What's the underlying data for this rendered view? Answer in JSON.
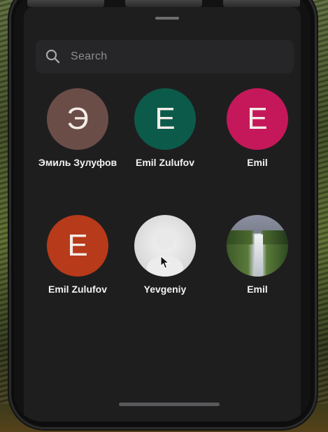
{
  "search": {
    "placeholder": "Search"
  },
  "contacts": [
    {
      "initial": "Э",
      "name": "Эмиль Зулуфов",
      "color": "#6b4d48",
      "avatar_type": "initial"
    },
    {
      "initial": "E",
      "name": "Emil Zulufov",
      "color": "#0c5a4a",
      "avatar_type": "initial"
    },
    {
      "initial": "E",
      "name": "Emil",
      "color": "#c4185a",
      "avatar_type": "initial"
    },
    {
      "initial": "E",
      "name": "Emil Zulufov",
      "color": "#b73a1a",
      "avatar_type": "initial"
    },
    {
      "initial": "",
      "name": "Yevgeniy",
      "color": "#e0e0e0",
      "avatar_type": "photo-person"
    },
    {
      "initial": "",
      "name": "Emil",
      "color": "#6a7a5a",
      "avatar_type": "photo-landscape"
    }
  ],
  "icons": {
    "search": "search-icon",
    "cursor": "mouse-pointer-icon"
  },
  "colors": {
    "sheet_background": "#1f1e1f",
    "search_background": "#262527",
    "text_primary": "#f2f2f2",
    "text_secondary": "#8e8e93"
  }
}
